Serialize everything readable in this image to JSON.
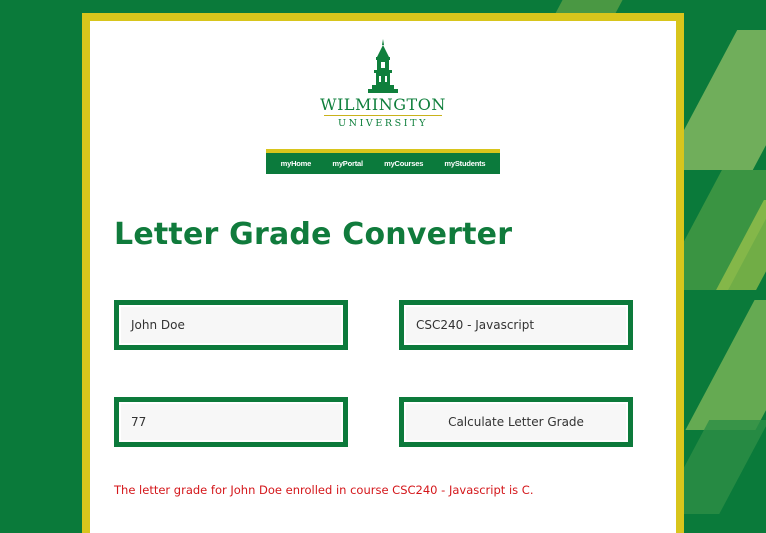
{
  "logo": {
    "name": "WILMINGTON",
    "sub": "UNIVERSITY"
  },
  "nav": {
    "items": [
      "myHome",
      "myPortal",
      "myCourses",
      "myStudents"
    ]
  },
  "page": {
    "title": "Letter Grade Converter"
  },
  "form": {
    "student_name": "John Doe",
    "course": "CSC240 - Javascript",
    "score": "77",
    "calculate_label": "Calculate Letter Grade"
  },
  "result": {
    "message": "The letter grade for John Doe enrolled in course CSC240 - Javascript is C."
  },
  "colors": {
    "brand_green": "#0c7a3b",
    "brand_gold": "#d8c51c",
    "result_red": "#d4161a"
  }
}
